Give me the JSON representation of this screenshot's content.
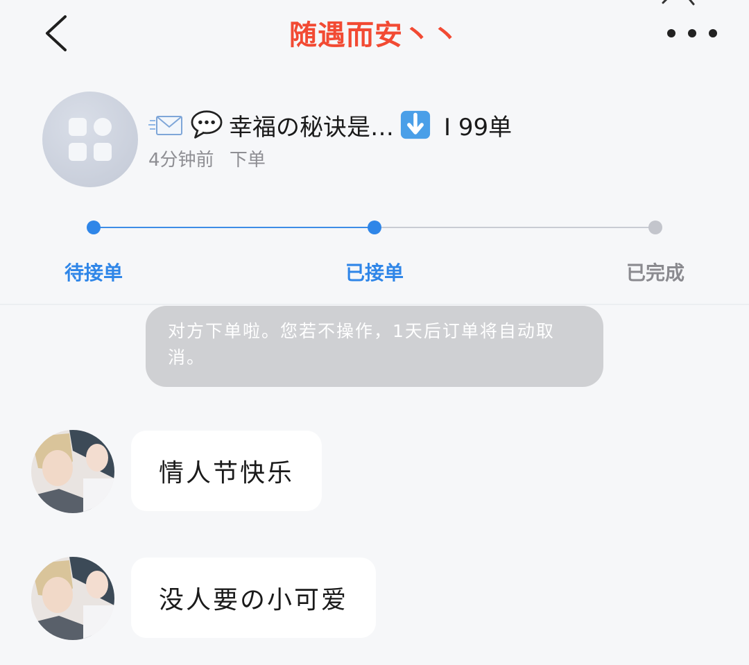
{
  "nav": {
    "title": "随遇而安丶丶",
    "title_color": "#f24a33",
    "back_icon": "chevron-left-icon",
    "more_icon": "more-dots-icon"
  },
  "order": {
    "avatar_icon": "app-grid-icon",
    "emoji_1": "envelope-emoji",
    "emoji_2": "speech-bubble-emoji",
    "summary": "幸福の秘诀是…",
    "emoji_3": "down-arrow-emoji",
    "count": "I 99单",
    "time": "4分钟前",
    "action": "下单"
  },
  "progress": {
    "current_step": 2,
    "active_color": "#2f86e8",
    "steps": [
      {
        "label": "待接单"
      },
      {
        "label": "已接单"
      },
      {
        "label": "已完成"
      }
    ]
  },
  "system_notice": "对方下单啦。您若不操作，1天后订单将自动取消。",
  "messages": [
    {
      "text": "情人节快乐"
    },
    {
      "text": "没人要の小可爱"
    }
  ]
}
